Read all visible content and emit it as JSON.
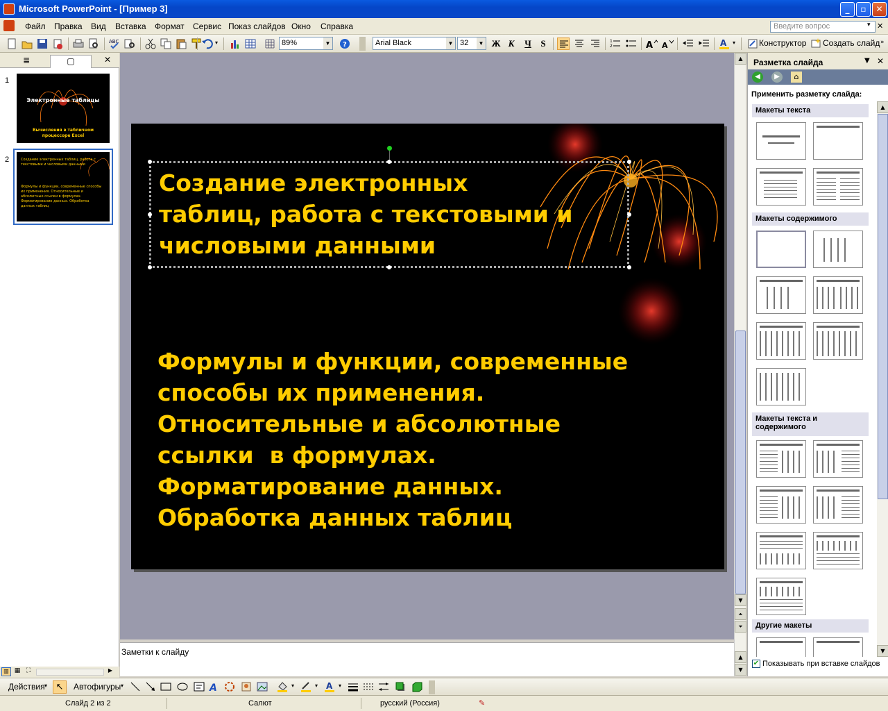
{
  "window": {
    "title": "Microsoft PowerPoint - [Пример 3]"
  },
  "menu": {
    "items": [
      "Файл",
      "Правка",
      "Вид",
      "Вставка",
      "Формат",
      "Сервис",
      "Показ слайдов",
      "Окно",
      "Справка"
    ],
    "help_placeholder": "Введите вопрос"
  },
  "toolbar": {
    "zoom": "89%",
    "font": "Arial Black",
    "font_size": "32",
    "designer": "Конструктор",
    "new_slide": "Создать слайд"
  },
  "slides": [
    {
      "num": "1",
      "title": "Электронные таблицы",
      "subtitle": "Вычисления в табличном процессоре Excel"
    },
    {
      "num": "2",
      "lines": [
        "Создание электронных таблиц, работа с текстовыми и числовыми данными",
        "Формулы и функции, современные способы их применения. Относительные и абсолютные ссылки в формулах. Форматирование данных. Обработка данных таблиц"
      ]
    }
  ],
  "slide": {
    "title_lines": [
      "Создание электронных",
      "таблиц, работа с текстовыми и",
      "числовыми данными"
    ],
    "body_lines": [
      "Формулы и функции, современные",
      "способы их применения.",
      "Относительные и абсолютные",
      "ссылки  в формулах.",
      "Форматирование данных.",
      "Обработка данных таблиц"
    ]
  },
  "notes": {
    "placeholder": "Заметки к слайду"
  },
  "task_pane": {
    "title": "Разметка слайда",
    "apply_label": "Применить разметку слайда:",
    "sections": [
      "Макеты текста",
      "Макеты содержимого",
      "Макеты текста и содержимого",
      "Другие макеты"
    ],
    "show_on_insert": "Показывать при вставке слайдов"
  },
  "drawing": {
    "actions": "Действия",
    "autoshapes": "Автофигуры"
  },
  "status": {
    "slide": "Слайд 2 из 2",
    "design": "Салют",
    "language": "русский (Россия)"
  },
  "colors": {
    "slide_text": "#ffcc00",
    "titlebar": "#0a5ae0",
    "slide_bg": "#000000"
  }
}
